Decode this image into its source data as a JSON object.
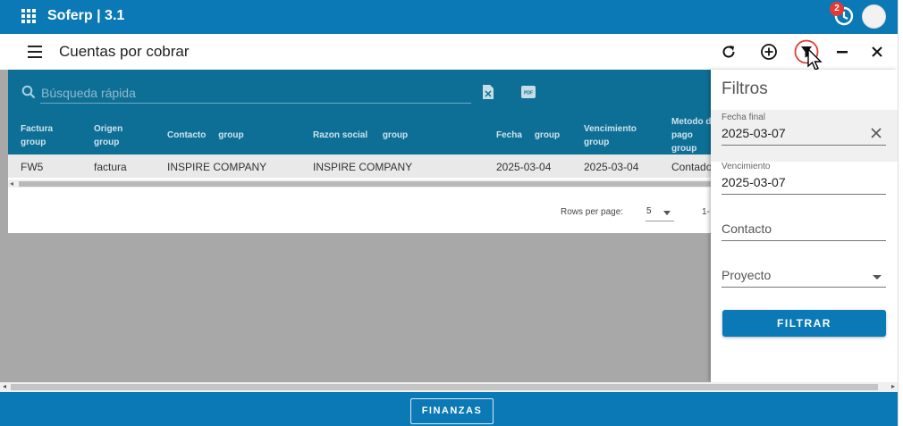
{
  "app": {
    "title": "Soferp | 3.1",
    "notification_count": "2"
  },
  "header": {
    "title": "Cuentas por cobrar"
  },
  "table": {
    "search_placeholder": "Búsqueda rápida",
    "columns": [
      {
        "line1": "Factura",
        "line2": "group"
      },
      {
        "line1": "Origen",
        "line2": "group"
      },
      {
        "line1": "Contacto",
        "line2": "group"
      },
      {
        "line1": "Razon social",
        "line2": "group"
      },
      {
        "line1": "Fecha",
        "line2": "group"
      },
      {
        "line1": "Vencimiento",
        "line2": "group"
      },
      {
        "line1": "Metodo d",
        "line2": "pago",
        "line3": "group"
      }
    ],
    "rows": [
      {
        "factura": "FW5",
        "origen": "factura",
        "contacto": "INSPIRE COMPANY",
        "razon_social": "INSPIRE COMPANY",
        "fecha": "2025-03-04",
        "vencimiento": "2025-03-04",
        "metodo": "Contado"
      }
    ],
    "pager": {
      "rows_per_page_label": "Rows per page:",
      "rows_per_page": "5",
      "range": "1-"
    }
  },
  "filters": {
    "title": "Filtros",
    "fecha_final_label": "Fecha final",
    "fecha_final_value": "2025-03-07",
    "vencimiento_label": "Vencimiento",
    "vencimiento_value": "2025-03-07",
    "contacto_placeholder": "Contacto",
    "proyecto_placeholder": "Proyecto",
    "filter_button": "FILTRAR"
  },
  "footer": {
    "module_button": "FINANZAS"
  },
  "colors": {
    "primary": "#0b79b6",
    "table_header": "#0e6f96",
    "overlay": "#a8a8a8",
    "badge": "#e53935",
    "highlight_ring": "#e53935"
  }
}
